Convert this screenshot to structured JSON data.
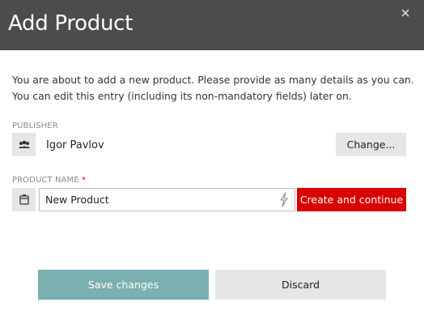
{
  "dialog": {
    "title": "Add Product",
    "close_icon": "close-icon"
  },
  "intro": {
    "line1": "You are about to add a new product. Please provide as many details as you can.",
    "line2": "You can edit this entry (including its non-mandatory fields) later on."
  },
  "publisher": {
    "label": "PUBLISHER",
    "icon": "users-icon",
    "name": "Igor Pavlov",
    "change_label": "Change..."
  },
  "product_name": {
    "label": "PRODUCT NAME",
    "required_marker": "*",
    "icon": "product-box-icon",
    "value": "New Product",
    "action_icon": "lightning-bolt-icon",
    "create_label": "Create and continue"
  },
  "footer": {
    "save_label": "Save changes",
    "discard_label": "Discard"
  },
  "colors": {
    "header_bg": "#4c4c4c",
    "primary_red": "#d90000",
    "save_teal": "#7ab0b0",
    "neutral_button": "#e6e6e6",
    "required_red": "#d00000"
  }
}
